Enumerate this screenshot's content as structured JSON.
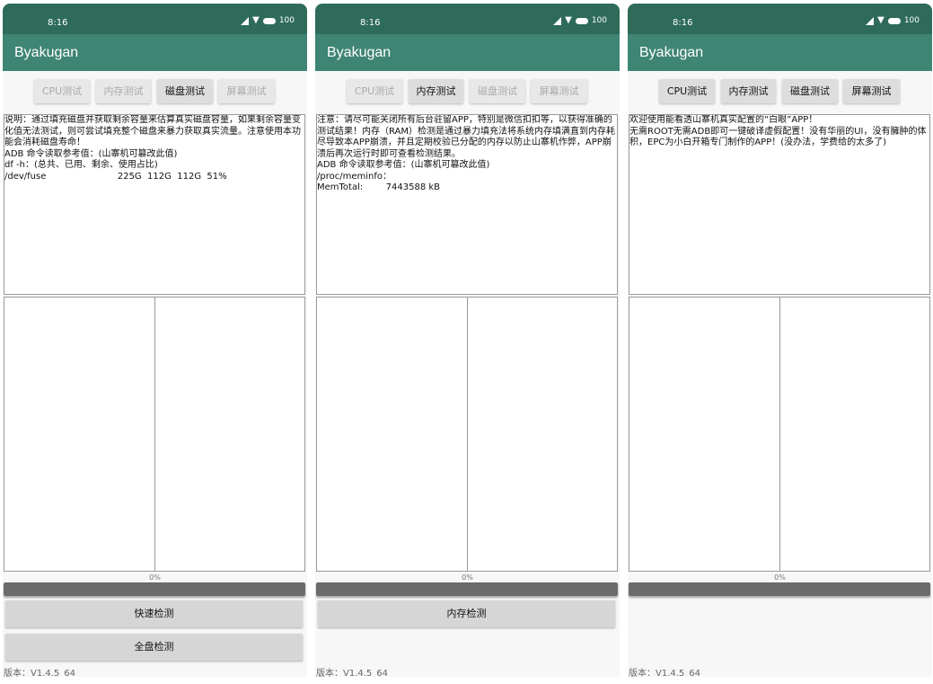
{
  "status_bar": {
    "time": "8:16",
    "battery": "100"
  },
  "app_title": "Byakugan",
  "tabs": [
    "CPU测试",
    "内存测试",
    "磁盘测试",
    "屏幕测试"
  ],
  "screens": [
    {
      "info_lines": [
        "说明：通过填充磁盘并获取剩余容量来估算真实磁盘容量，如果剩余容量变化值无法测试，则可尝试填充整个磁盘来暴力获取真实流量。注意使用本功能会消耗磁盘寿命！",
        "ADB 命令读取参考值：(山寨机可篡改此值)",
        "df -h：(总共、已用、剩余、使用占比)",
        "/dev/fuse                         225G  112G  112G  51%"
      ],
      "progress_text": "0%",
      "progress_value": 0,
      "buttons": [
        "快速检测",
        "全盘检测"
      ],
      "version": "版本：V1.4.5_64"
    },
    {
      "info_lines": [
        "注意：请尽可能关闭所有后台驻留APP，特别是微信扣扣等，以获得准确的测试结果！内存（RAM）检测是通过暴力填充法将系统内存填满直到内存耗尽导致本APP崩溃，并且定期校验已分配的内存以防止山寨机作弊，APP崩溃后再次运行时即可查看检测结果。",
        "ADB 命令读取参考值：(山寨机可篡改此值)",
        "/proc/meminfo：",
        "MemTotal:        7443588 kB"
      ],
      "progress_text": "0%",
      "progress_value": 0,
      "buttons": [
        "内存检测"
      ],
      "version": "版本：V1.4.5_64"
    },
    {
      "info_lines": [
        "欢迎使用能看透山寨机真实配置的“白眼”APP！",
        "无需ROOT无需ADB即可一键破译虚假配置！没有华丽的UI，没有臃肿的体积，EPC为小白开箱专门制作的APP！(没办法，学费给的太多了)"
      ],
      "progress_text": "0%",
      "progress_value": 0,
      "buttons": [],
      "version": "版本：V1.4.5_64"
    }
  ]
}
